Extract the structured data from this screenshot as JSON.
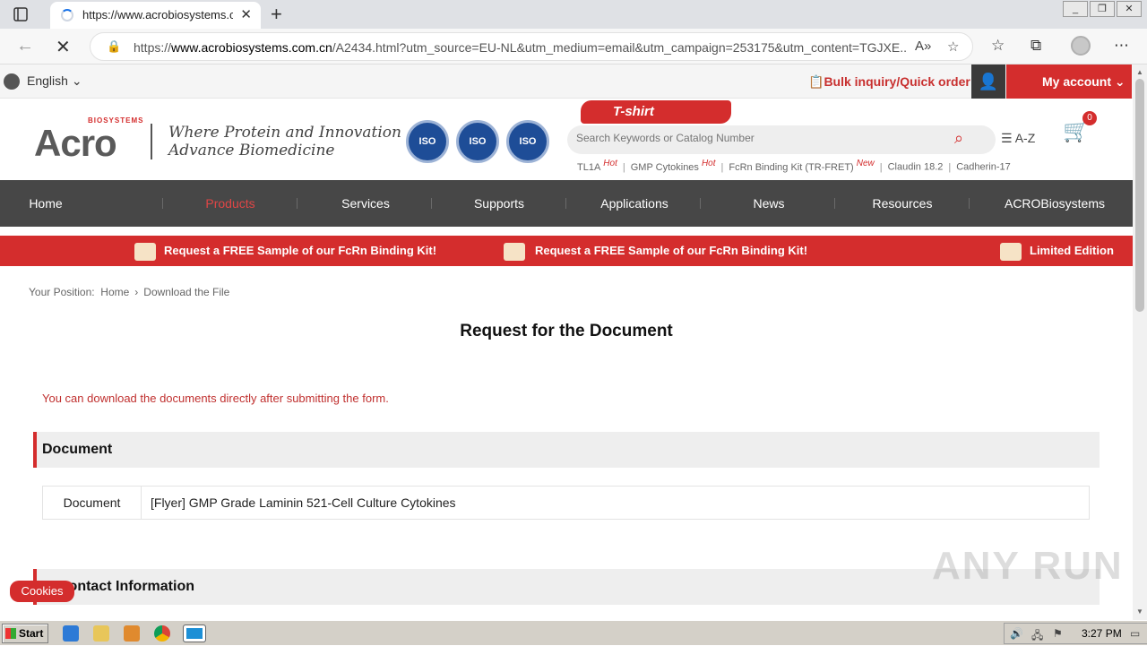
{
  "browser": {
    "tab_title": "https://www.acrobiosystems.cc",
    "url_prefix": "https://",
    "url_host": "www.acrobiosystems.com.cn",
    "url_path": "/A2434.html?utm_source=EU-NL&utm_medium=email&utm_campaign=253175&utm_content=TGJXE..."
  },
  "topbar": {
    "language": "English",
    "bulk_inquiry": "Bulk inquiry/Quick order",
    "my_account": "My account"
  },
  "header": {
    "logo_text": "Acro",
    "logo_sub": "BIOSYSTEMS",
    "slogan_line1": "Where Protein and Innovation",
    "slogan_line2": "Advance Biomedicine",
    "iso_badges": [
      "ISO",
      "ISO",
      "ISO"
    ],
    "promo_badge": "T-shirt",
    "search_placeholder": "Search Keywords or Catalog Number",
    "az_label": "A-Z",
    "cart_count": "0",
    "hot_links": [
      {
        "label": "TL1A",
        "tag": "Hot"
      },
      {
        "label": "GMP Cytokines",
        "tag": "Hot"
      },
      {
        "label": "FcRn Binding Kit (TR-FRET)",
        "tag": "New"
      },
      {
        "label": "Claudin 18.2",
        "tag": ""
      },
      {
        "label": "Cadherin-17",
        "tag": ""
      }
    ]
  },
  "nav": {
    "items": [
      "Home",
      "Products",
      "Services",
      "Supports",
      "Applications",
      "News",
      "Resources",
      "ACROBiosystems"
    ],
    "active": "Products"
  },
  "promo_banner": {
    "msg1": "Request a FREE Sample of our FcRn Binding Kit!",
    "msg2": "Request a FREE Sample of our FcRn Binding Kit!",
    "msg3": "Limited Edition"
  },
  "breadcrumb": {
    "label": "Your Position:",
    "home": "Home",
    "current": "Download the File"
  },
  "main": {
    "title": "Request for the Document",
    "notice": "You can download the documents directly after submitting the form.",
    "section_document": "Document",
    "doc_label": "Document",
    "doc_value": "[Flyer] GMP Grade Laminin 521-Cell Culture Cytokines",
    "section_contact": "Contact Information"
  },
  "cookies_label": "Cookies",
  "watermark": "ANY RUN",
  "taskbar": {
    "start": "Start",
    "clock": "3:27 PM"
  },
  "colors": {
    "brand_red": "#d42d2d",
    "nav_gray": "#474747"
  }
}
